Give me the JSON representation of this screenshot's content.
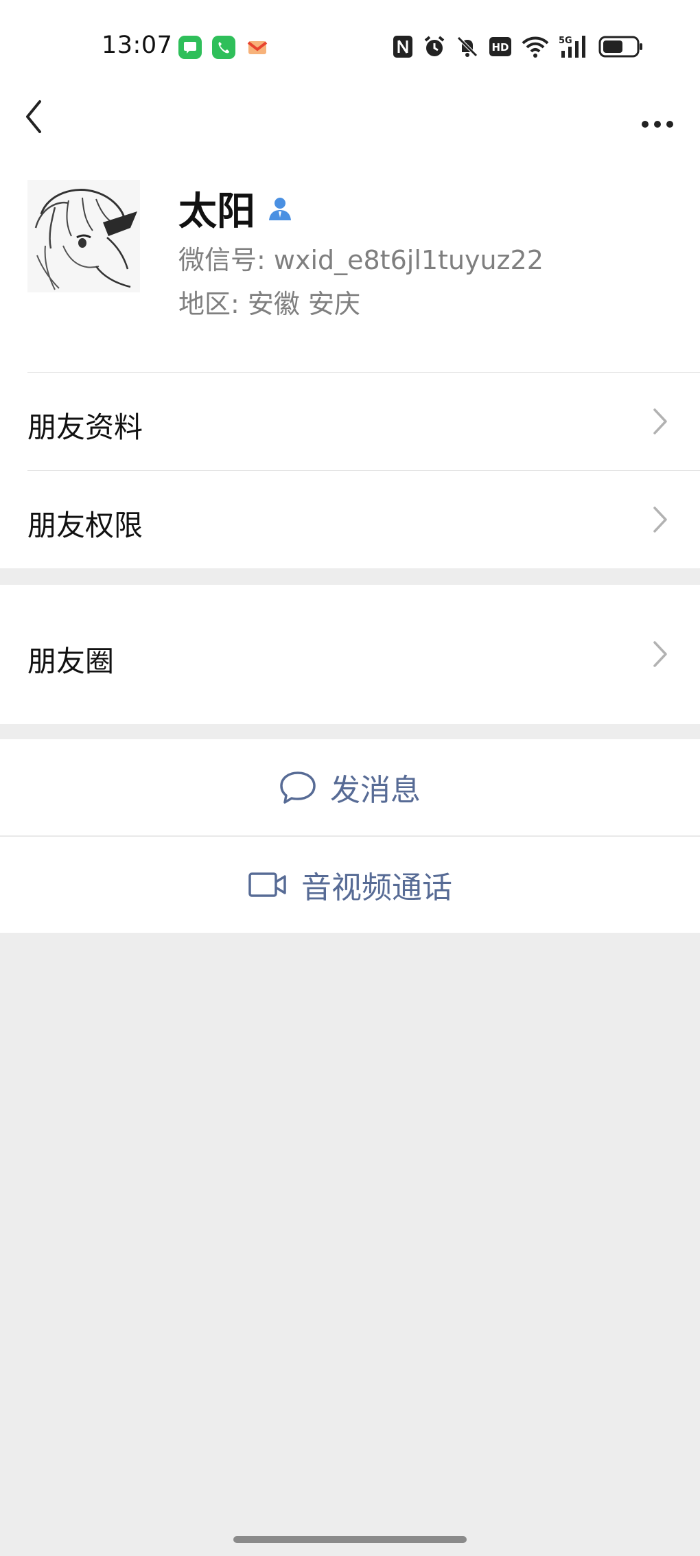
{
  "status_bar": {
    "time": "13:07",
    "notification_icons": [
      "messages-icon",
      "phone-icon",
      "mail-icon"
    ],
    "system_icons": [
      "nfc-icon",
      "alarm-icon",
      "mute-icon",
      "hd-icon",
      "wifi-icon",
      "signal-5g-icon",
      "battery-icon"
    ],
    "network_label": "5G",
    "hd_label": "HD"
  },
  "nav": {
    "back_icon": "chevron-left-icon",
    "more_icon": "more-dots-icon"
  },
  "profile": {
    "name": "太阳",
    "wechat_id": "微信号:  wxid_e8t6jl1tuyuz22",
    "region": "地区:  安徽  安庆",
    "contact_icon_color": "#4a90e2"
  },
  "menu": {
    "friend_info": "朋友资料",
    "friend_permissions": "朋友权限",
    "moments": "朋友圈"
  },
  "actions": {
    "send_message": "发消息",
    "video_call": "音视频通话",
    "accent_color": "#576b95"
  }
}
